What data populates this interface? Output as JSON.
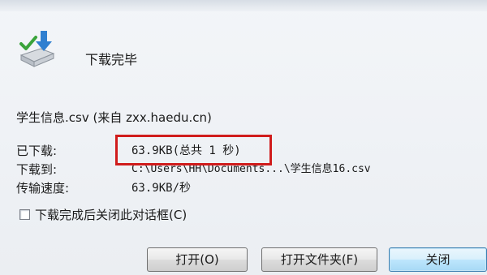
{
  "header": {
    "title": "下载完毕"
  },
  "file": {
    "name": "学生信息.csv",
    "source": "(来自 zxx.haedu.cn)"
  },
  "info": {
    "downloaded_label": "已下载:",
    "downloaded_value": "63.9KB(总共 1 秒)",
    "saved_to_label": "下载到:",
    "saved_to_value": "C:\\Users\\HH\\Documents...\\学生信息16.csv",
    "speed_label": "传输速度:",
    "speed_value": "63.9KB/秒"
  },
  "checkbox": {
    "label": "下载完成后关闭此对话框(C)",
    "checked": false
  },
  "buttons": {
    "open": "打开(O)",
    "open_folder": "打开文件夹(F)",
    "close": "关闭"
  },
  "colors": {
    "highlight": "#d01c1c",
    "primary_button": "#a7d9f5"
  },
  "icons": {
    "download": "download-complete-icon"
  }
}
